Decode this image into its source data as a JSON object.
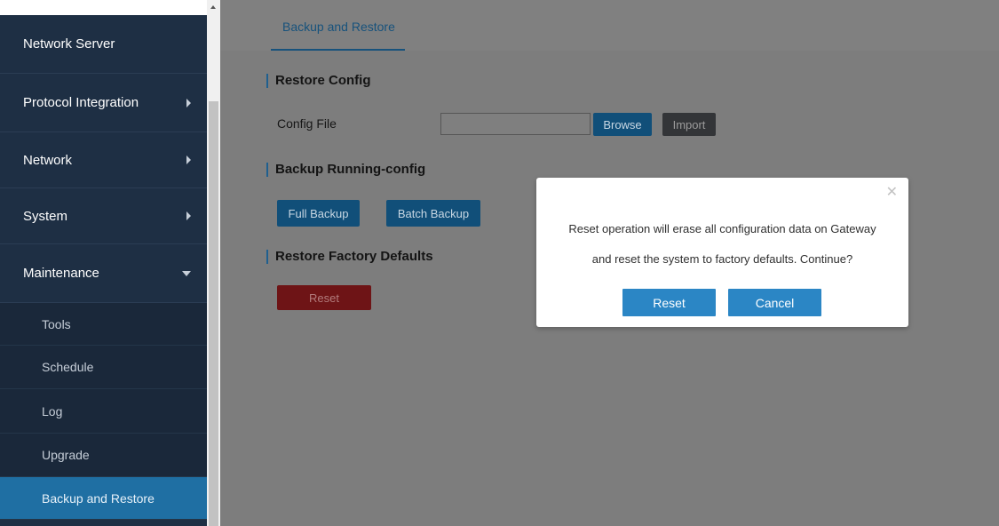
{
  "sidebar": {
    "items": [
      {
        "label": "Network Server",
        "has_arrow": false
      },
      {
        "label": "Protocol Integration",
        "has_arrow": true
      },
      {
        "label": "Network",
        "has_arrow": true
      },
      {
        "label": "System",
        "has_arrow": true
      },
      {
        "label": "Maintenance",
        "has_arrow": true,
        "expanded": true
      }
    ],
    "subitems": [
      {
        "label": "Tools"
      },
      {
        "label": "Schedule"
      },
      {
        "label": "Log"
      },
      {
        "label": "Upgrade"
      },
      {
        "label": "Backup and Restore",
        "active": true
      }
    ]
  },
  "tabs": {
    "active_label": "Backup and Restore"
  },
  "main": {
    "restore_config": {
      "title": "Restore Config",
      "config_file_label": "Config File",
      "config_file_value": "",
      "browse_label": "Browse",
      "import_label": "Import"
    },
    "backup_running": {
      "title": "Backup Running-config",
      "full_backup_label": "Full Backup",
      "batch_backup_label": "Batch Backup"
    },
    "factory_defaults": {
      "title": "Restore Factory Defaults",
      "reset_label": "Reset"
    }
  },
  "modal": {
    "close_icon": "close-icon",
    "message_line1": "Reset operation will erase all configuration data on Gateway",
    "message_line2": "and reset the system to factory defaults. Continue?",
    "confirm_label": "Reset",
    "cancel_label": "Cancel"
  },
  "colors": {
    "sidebar_bg": "#1e2f44",
    "active_item": "#1f6fa3",
    "accent_blue": "#2b86c5",
    "danger": "#c9302c"
  }
}
